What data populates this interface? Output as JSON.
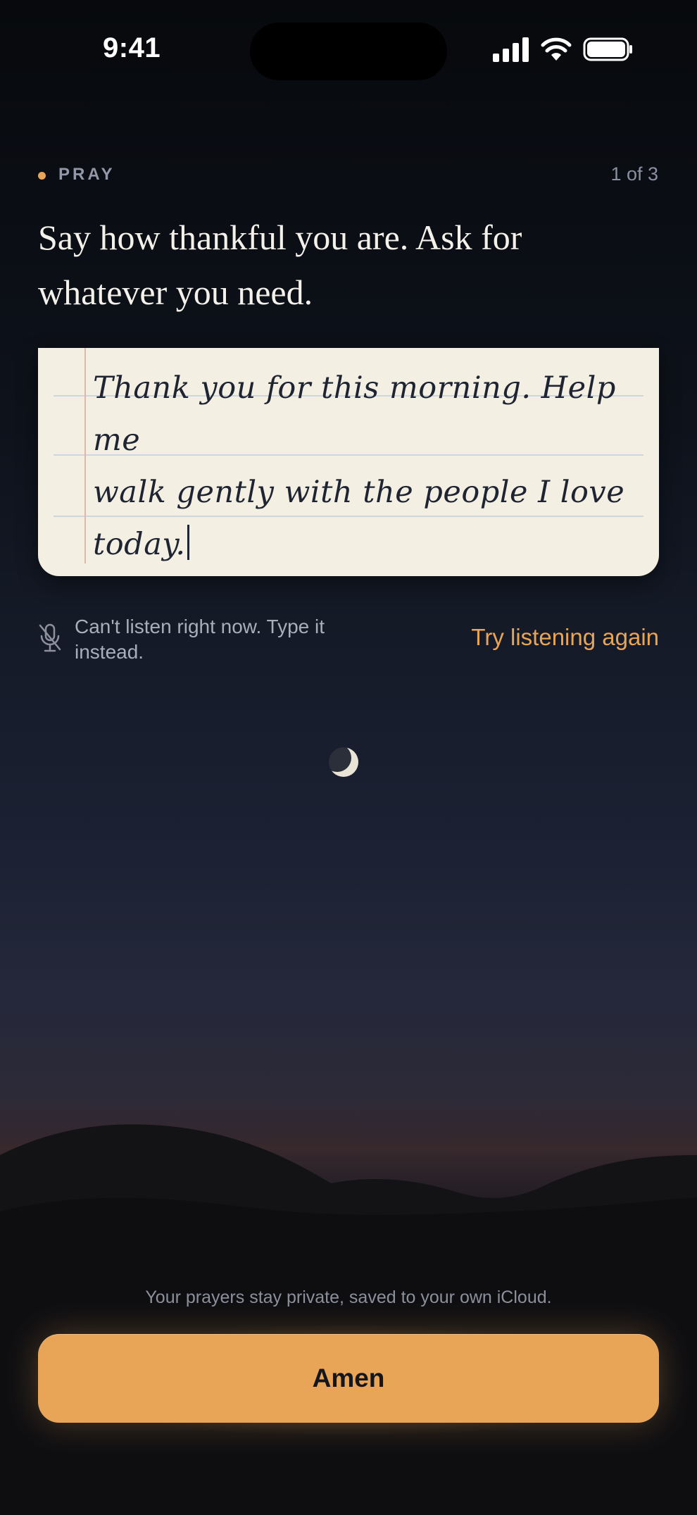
{
  "status_bar": {
    "time": "9:41",
    "icons": [
      "cellular-signal-icon",
      "wifi-icon",
      "battery-icon"
    ]
  },
  "header": {
    "step_label": "PRAY",
    "step_counter": "1 of 3",
    "accent_color": "#e8a457"
  },
  "prompt": {
    "text": "Say how thankful you are. Ask for whatever you need."
  },
  "note": {
    "lines": [
      "Thank you for this morning. Help me",
      "walk gently with the people I love",
      "today."
    ],
    "paper_color": "#f4efe3",
    "ink_color": "#1f2433"
  },
  "listening": {
    "icon": "mic-off-icon",
    "status_text": "Can't listen right now. Type it instead.",
    "retry_label": "Try listening again"
  },
  "scenery": {
    "icons": [
      "crescent-moon-icon",
      "hills-silhouette"
    ]
  },
  "footer": {
    "privacy_text": "Your prayers stay private, saved to your own iCloud.",
    "amen_label": "Amen",
    "button_color": "#e8a457"
  }
}
